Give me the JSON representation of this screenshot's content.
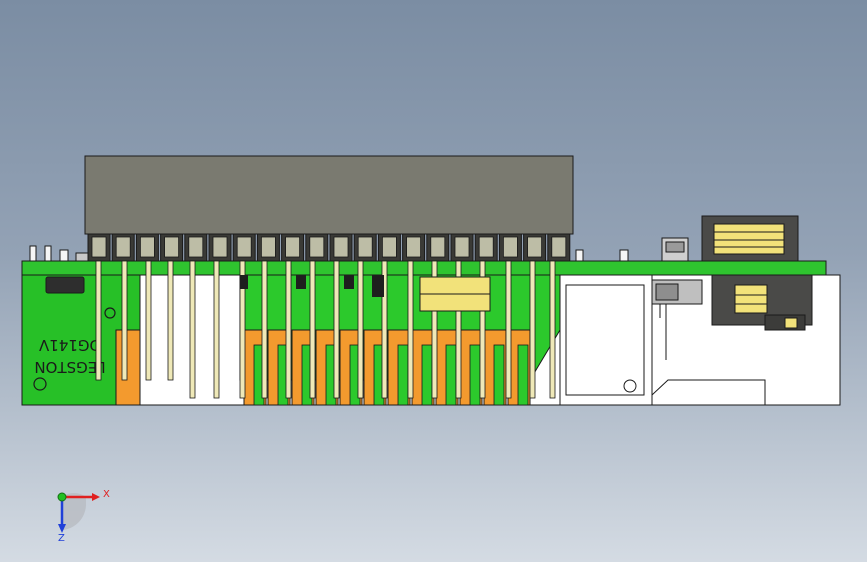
{
  "viewport": {
    "board_text_line1": "LEGSTON",
    "board_text_line2": "DG141V",
    "colors": {
      "pcb_green": "#22b522",
      "pcb_green_light": "#3ad83a",
      "connector_housing": "#7a7a70",
      "terminal_orange": "#f39a2e",
      "transformer_yellow": "#f2e27a",
      "pin_cream": "#efe9b8",
      "outline": "#1a1a1a"
    }
  },
  "triad": {
    "x_label": "X",
    "y_label": "Y",
    "z_label": "Z"
  }
}
